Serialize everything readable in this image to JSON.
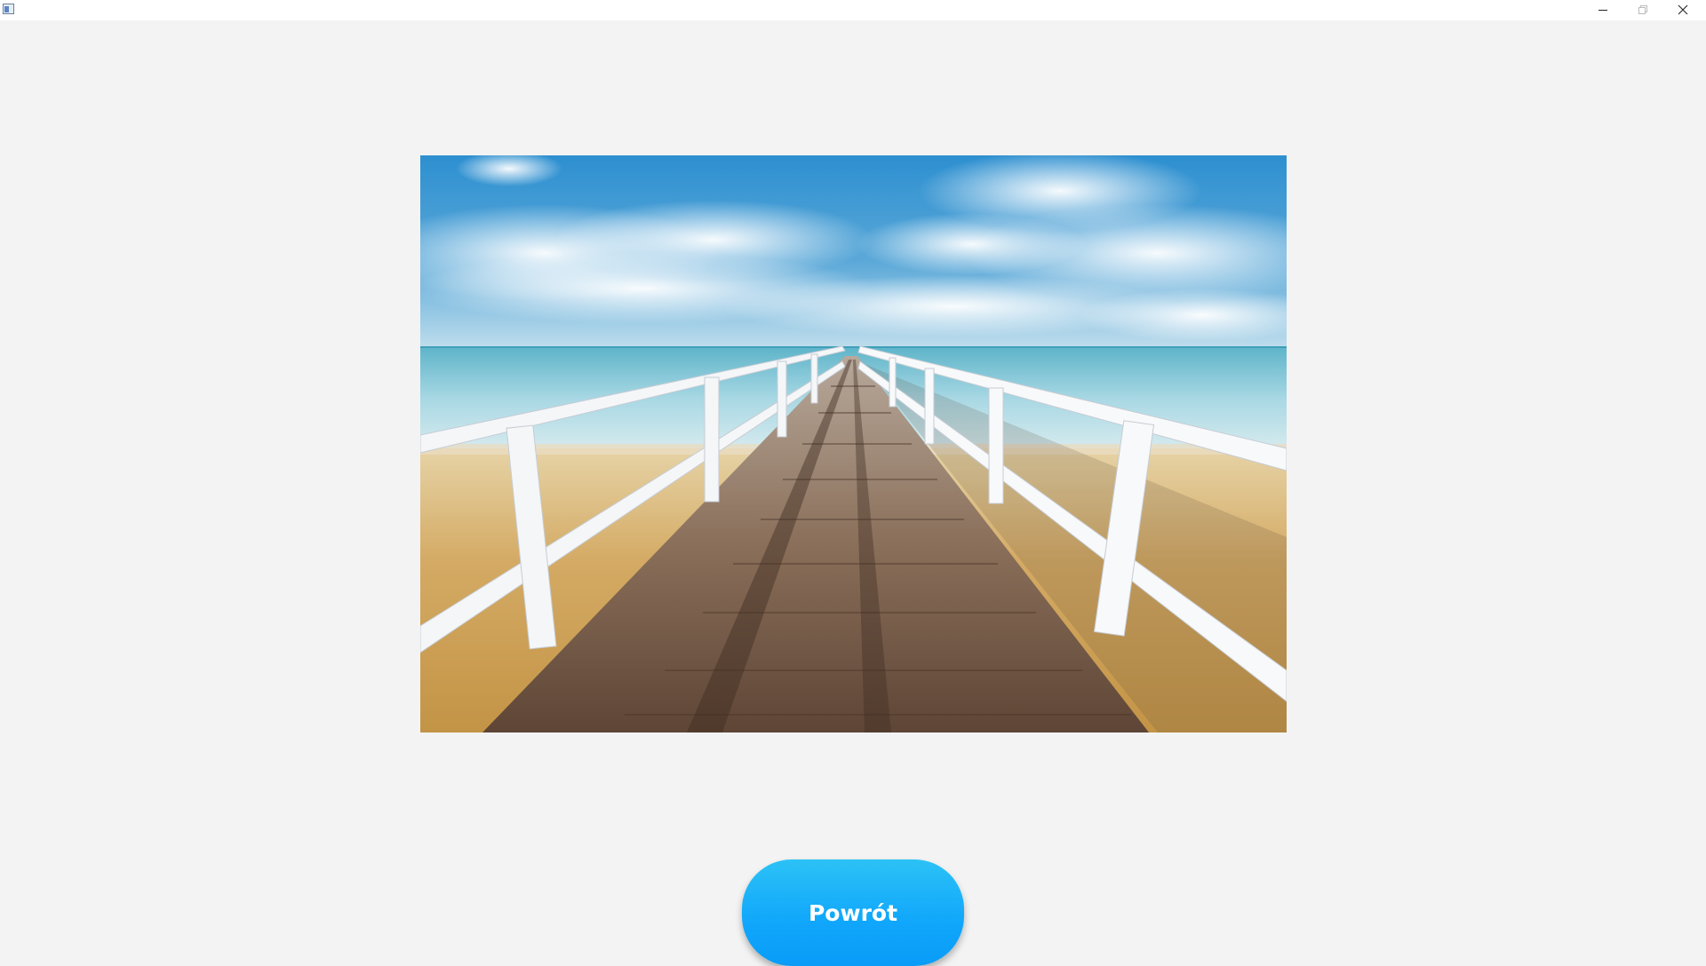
{
  "window": {
    "title": "",
    "controls": {
      "minimize_icon": "minimize-icon",
      "maximize_icon": "restore-icon",
      "close_icon": "close-icon"
    }
  },
  "main": {
    "image": {
      "subject": "pier-over-sea-photo"
    },
    "back_button": {
      "label": "Powrót",
      "color": "#10a6fb"
    }
  }
}
